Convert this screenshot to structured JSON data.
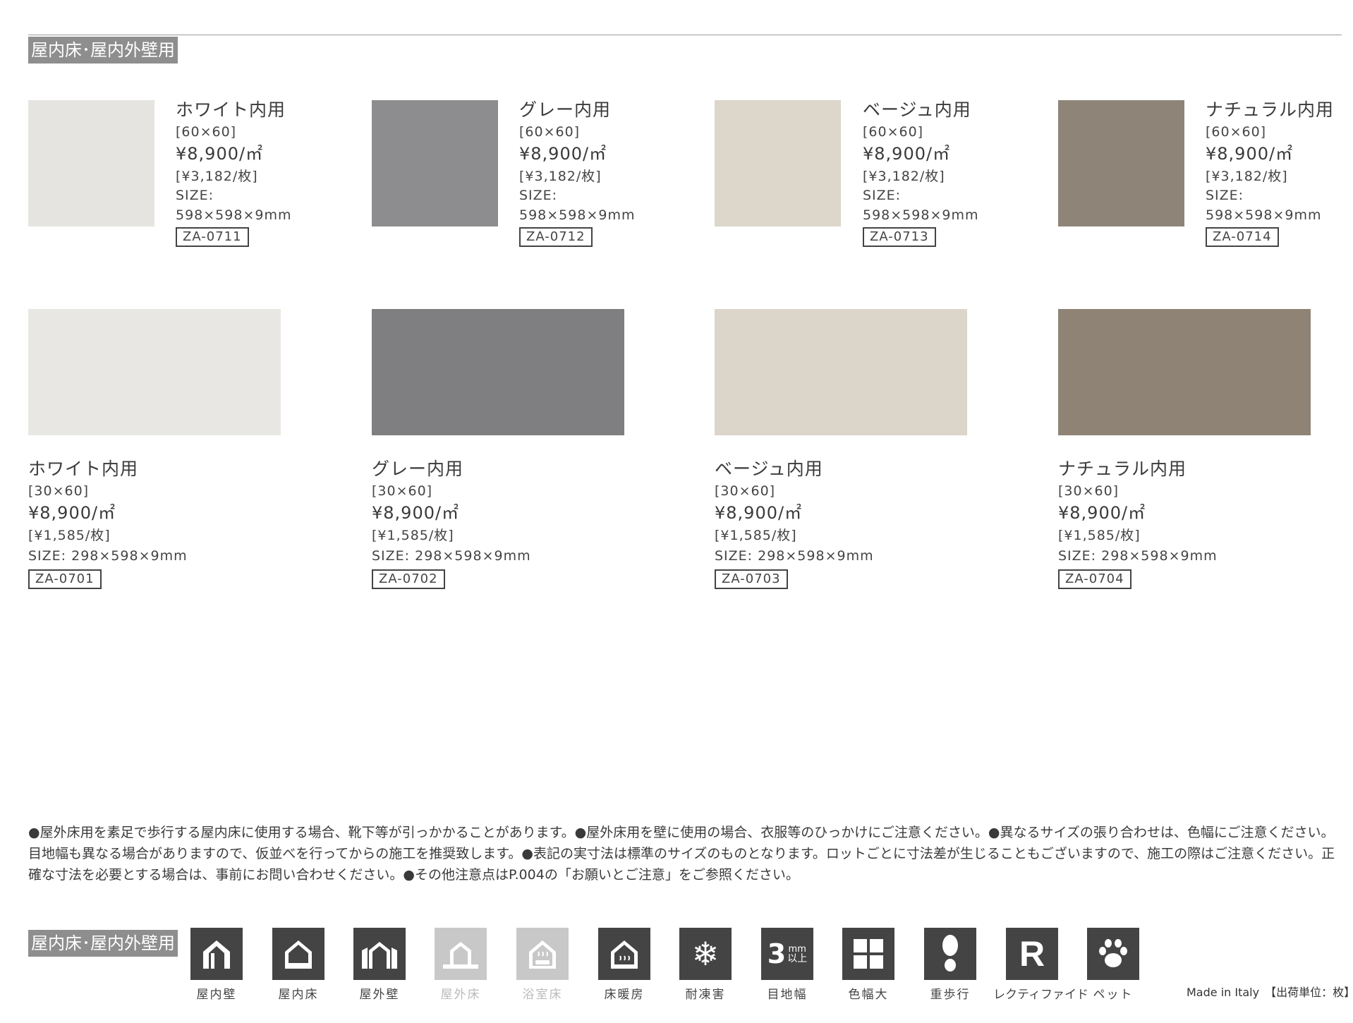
{
  "section_tag": "屋内床･屋内外壁用",
  "products_row1": [
    {
      "name": "ホワイト内用",
      "size_label": "[60×60]",
      "price": "¥8,900/㎡",
      "per_piece": "[¥3,182/枚]",
      "size_title": "SIZE:",
      "size_value": "598×598×9mm",
      "code": "ZA-0711",
      "color": "#e6e4e0"
    },
    {
      "name": "グレー内用",
      "size_label": "[60×60]",
      "price": "¥8,900/㎡",
      "per_piece": "[¥3,182/枚]",
      "size_title": "SIZE:",
      "size_value": "598×598×9mm",
      "code": "ZA-0712",
      "color": "#8d8d8f"
    },
    {
      "name": "ベージュ内用",
      "size_label": "[60×60]",
      "price": "¥8,900/㎡",
      "per_piece": "[¥3,182/枚]",
      "size_title": "SIZE:",
      "size_value": "598×598×9mm",
      "code": "ZA-0713",
      "color": "#dcd6cb"
    },
    {
      "name": "ナチュラル内用",
      "size_label": "[60×60]",
      "price": "¥8,900/㎡",
      "per_piece": "[¥3,182/枚]",
      "size_title": "SIZE:",
      "size_value": "598×598×9mm",
      "code": "ZA-0714",
      "color": "#8f8478"
    }
  ],
  "products_row2": [
    {
      "name": "ホワイト内用",
      "size_label": "[30×60]",
      "price": "¥8,900/㎡",
      "per_piece": "[¥1,585/枚]",
      "size_line": "SIZE: 298×598×9mm",
      "code": "ZA-0701",
      "color": "#e9e7e3"
    },
    {
      "name": "グレー内用",
      "size_label": "[30×60]",
      "price": "¥8,900/㎡",
      "per_piece": "[¥1,585/枚]",
      "size_line": "SIZE: 298×598×9mm",
      "code": "ZA-0702",
      "color": "#7f7e80"
    },
    {
      "name": "ベージュ内用",
      "size_label": "[30×60]",
      "price": "¥8,900/㎡",
      "per_piece": "[¥1,585/枚]",
      "size_line": "SIZE: 298×598×9mm",
      "code": "ZA-0703",
      "color": "#dbd5ca"
    },
    {
      "name": "ナチュラル内用",
      "size_label": "[30×60]",
      "price": "¥8,900/㎡",
      "per_piece": "[¥1,585/枚]",
      "size_line": "SIZE: 298×598×9mm",
      "code": "ZA-0704",
      "color": "#8e8375"
    }
  ],
  "notes": "●屋外床用を素足で歩行する屋内床に使用する場合、靴下等が引っかかることがあります。●屋外床用を壁に使用の場合、衣服等のひっかけにご注意ください。●異なるサイズの張り合わせは、色幅にご注意ください。目地幅も異なる場合がありますので、仮並べを行ってからの施工を推奨致します。●表記の実寸法は標準のサイズのものとなります。ロットごとに寸法差が生じることもございますので、施工の際はご注意ください。正確な寸法を必要とする場合は、事前にお問い合わせください。●その他注意点はP.004の「お願いとご注意」をご参照ください。",
  "footer_tag": "屋内床･屋内外壁用",
  "icons": [
    {
      "label": "屋内壁",
      "icon": "indoor-wall-icon",
      "enabled": true
    },
    {
      "label": "屋内床",
      "icon": "indoor-floor-icon",
      "enabled": true
    },
    {
      "label": "屋外壁",
      "icon": "outdoor-wall-icon",
      "enabled": true
    },
    {
      "label": "屋外床",
      "icon": "outdoor-floor-icon",
      "enabled": false
    },
    {
      "label": "浴室床",
      "icon": "bathroom-floor-icon",
      "enabled": false
    },
    {
      "label": "床暖房",
      "icon": "floor-heating-icon",
      "enabled": true
    },
    {
      "label": "耐凍害",
      "icon": "frost-resistant-icon",
      "enabled": true
    },
    {
      "label": "目地幅",
      "icon": "joint-width-icon",
      "enabled": true,
      "text_main": "3",
      "text_unit": "mm",
      "text_sub": "以上"
    },
    {
      "label": "色幅大",
      "icon": "color-variation-icon",
      "enabled": true
    },
    {
      "label": "重歩行",
      "icon": "heavy-traffic-icon",
      "enabled": true
    },
    {
      "label": "レクティファイド",
      "icon": "rectified-icon",
      "enabled": true,
      "text_main": "R"
    },
    {
      "label": "ペット",
      "icon": "pet-icon",
      "enabled": true
    }
  ],
  "made_in": "Made in Italy　【出荷単位：枚】"
}
